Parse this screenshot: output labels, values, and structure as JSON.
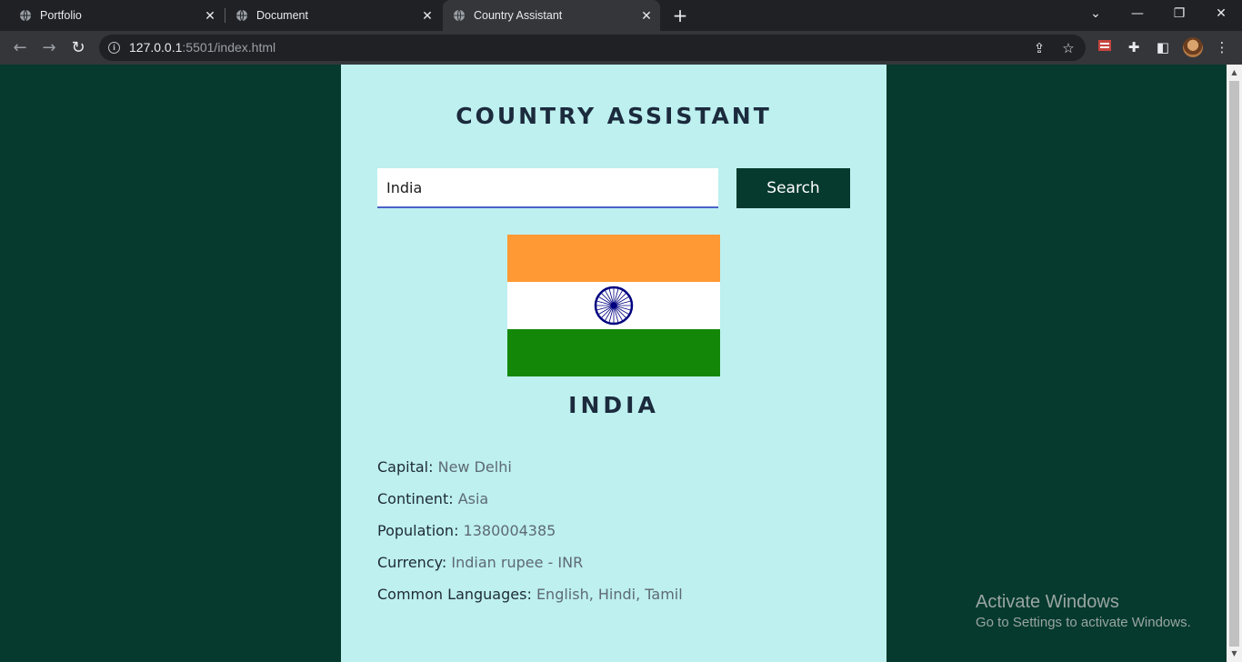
{
  "browser": {
    "tabs": [
      {
        "title": "Portfolio",
        "active": false
      },
      {
        "title": "Document",
        "active": false
      },
      {
        "title": "Country Assistant",
        "active": true
      }
    ],
    "url_host": "127.0.0.1",
    "url_rest": ":5501/index.html",
    "icons": [
      "back-icon",
      "forward-icon",
      "reload-icon",
      "site-info-icon",
      "share-icon",
      "bookmark-star-icon",
      "extension-icon",
      "puzzle-icon",
      "side-panel-icon",
      "avatar",
      "menu-icon"
    ]
  },
  "app": {
    "title": "COUNTRY ASSISTANT",
    "search": {
      "value": "India",
      "button_label": "Search"
    },
    "country": {
      "name": "INDIA",
      "flag": {
        "colors": [
          "#ff9933",
          "#ffffff",
          "#138808"
        ],
        "chakra_color": "#000080"
      },
      "details": [
        {
          "label": "Capital:",
          "value": "New Delhi"
        },
        {
          "label": "Continent:",
          "value": "Asia"
        },
        {
          "label": "Population:",
          "value": "1380004385"
        },
        {
          "label": "Currency:",
          "value": "Indian rupee - INR"
        },
        {
          "label": "Common Languages:",
          "value": "English, Hindi, Tamil"
        }
      ]
    }
  },
  "watermark": {
    "line1": "Activate Windows",
    "line2": "Go to Settings to activate Windows."
  },
  "colors": {
    "page_bg": "#063a2e",
    "card_bg": "#bdf0ef",
    "button_bg": "#063a2e"
  }
}
